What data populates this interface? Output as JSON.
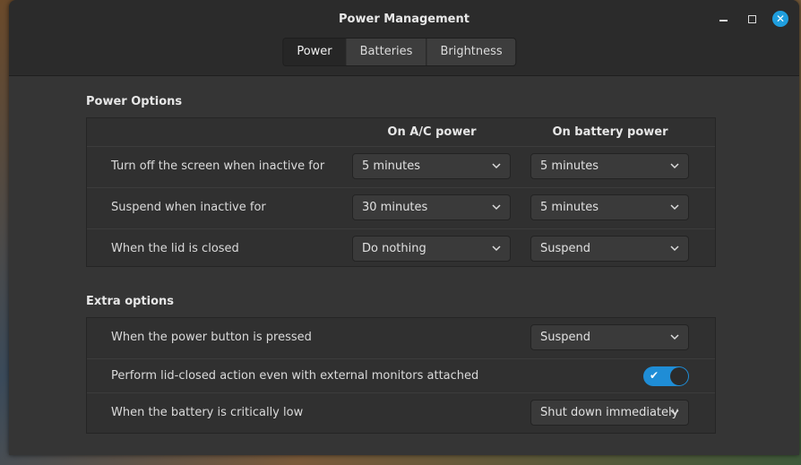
{
  "window": {
    "title": "Power Management",
    "controls": [
      "minimize-icon",
      "maximize-icon",
      "close-icon"
    ]
  },
  "tabs": [
    {
      "label": "Power",
      "active": true
    },
    {
      "label": "Batteries",
      "active": false
    },
    {
      "label": "Brightness",
      "active": false
    }
  ],
  "power_options": {
    "title": "Power Options",
    "col_ac": "On A/C power",
    "col_battery": "On battery power",
    "rows": [
      {
        "label": "Turn off the screen when inactive for",
        "ac": "5 minutes",
        "battery": "5 minutes"
      },
      {
        "label": "Suspend when inactive for",
        "ac": "30 minutes",
        "battery": "5 minutes"
      },
      {
        "label": "When the lid is closed",
        "ac": "Do nothing",
        "battery": "Suspend"
      }
    ]
  },
  "extra_options": {
    "title": "Extra options",
    "power_button": {
      "label": "When the power button is pressed",
      "value": "Suspend"
    },
    "lid_external": {
      "label": "Perform lid-closed action even with external monitors attached",
      "checked": true
    },
    "battery_low": {
      "label": "When the battery is critically low",
      "value": "Shut down immediately"
    }
  },
  "colors": {
    "accent": "#1f8dd6",
    "window_bg": "#353535",
    "titlebar_bg": "#2b2b2b"
  }
}
